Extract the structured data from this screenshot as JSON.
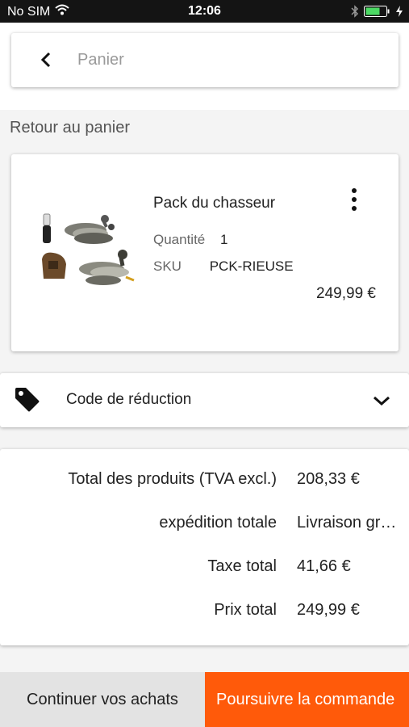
{
  "status_bar": {
    "carrier": "No SIM",
    "time": "12:06"
  },
  "header": {
    "title": "Panier",
    "back_icon": "chevron-left-icon"
  },
  "return_label": "Retour au panier",
  "product": {
    "name": "Pack du chasseur",
    "quantity_label": "Quantité",
    "quantity_value": "1",
    "sku_label": "SKU",
    "sku_value": "PCK-RIEUSE",
    "price": "249,99 €",
    "menu_icon": "more-vertical-icon"
  },
  "discount": {
    "label": "Code de réduction",
    "icon": "tag-icon",
    "expand_icon": "chevron-down-icon"
  },
  "totals": [
    {
      "label": "Total des produits (TVA excl.)",
      "value": "208,33 €"
    },
    {
      "label": "expédition totale",
      "value": "Livraison gratuite"
    },
    {
      "label": "Taxe total",
      "value": "41,66 €"
    },
    {
      "label": "Prix total",
      "value": "249,99 €"
    }
  ],
  "footer": {
    "continue_label": "Continuer vos achats",
    "checkout_label": "Poursuivre la commande"
  },
  "colors": {
    "accent": "#ff5a0a",
    "status_bar": "#141414",
    "footer_secondary": "#e3e3e3",
    "battery": "#4cd964"
  }
}
